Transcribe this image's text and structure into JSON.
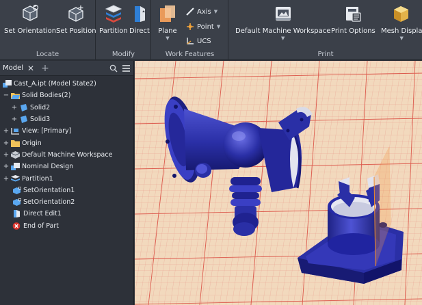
{
  "ribbon": {
    "groups": {
      "locate": "Locate",
      "modify": "Modify",
      "work_features": "Work Features",
      "print": "Print"
    },
    "tools": {
      "set_orientation": "Set Orientation",
      "set_position": "Set Position",
      "partition": "Partition",
      "direct": "Direct",
      "plane": "Plane",
      "axis": "Axis",
      "point": "Point",
      "ucs": "UCS",
      "default_machine_workspace": "Default Machine Workspace",
      "print_options": "Print Options",
      "mesh_display": "Mesh Displa"
    }
  },
  "browser": {
    "tab": "Model",
    "items": [
      {
        "label": "Cast_A.ipt (Model State2)",
        "icon": "part-icon"
      },
      {
        "label": "Solid Bodies(2)",
        "icon": "folder-open-icon"
      },
      {
        "label": "Solid2",
        "icon": "solid-body-icon"
      },
      {
        "label": "Solid3",
        "icon": "solid-body-icon"
      },
      {
        "label": "View: [Primary]",
        "icon": "view-icon"
      },
      {
        "label": "Origin",
        "icon": "folder-icon"
      },
      {
        "label": "Default Machine Workspace",
        "icon": "workspace-icon"
      },
      {
        "label": "Nominal Design",
        "icon": "part-icon"
      },
      {
        "label": "Partition1",
        "icon": "partition-icon"
      },
      {
        "label": "SetOrientation1",
        "icon": "orientation-icon"
      },
      {
        "label": "SetOrientation2",
        "icon": "orientation-icon"
      },
      {
        "label": "Direct Edit1",
        "icon": "direct-edit-icon"
      },
      {
        "label": "End of Part",
        "icon": "end-of-part-icon"
      }
    ]
  },
  "colors": {
    "accent_blue": "#2f7fd6",
    "build_plate": "#f2d9bd",
    "grid_line": "#e06a5a",
    "part_blue": "#2a2fa6",
    "end_of_part_red": "#d9352e"
  }
}
